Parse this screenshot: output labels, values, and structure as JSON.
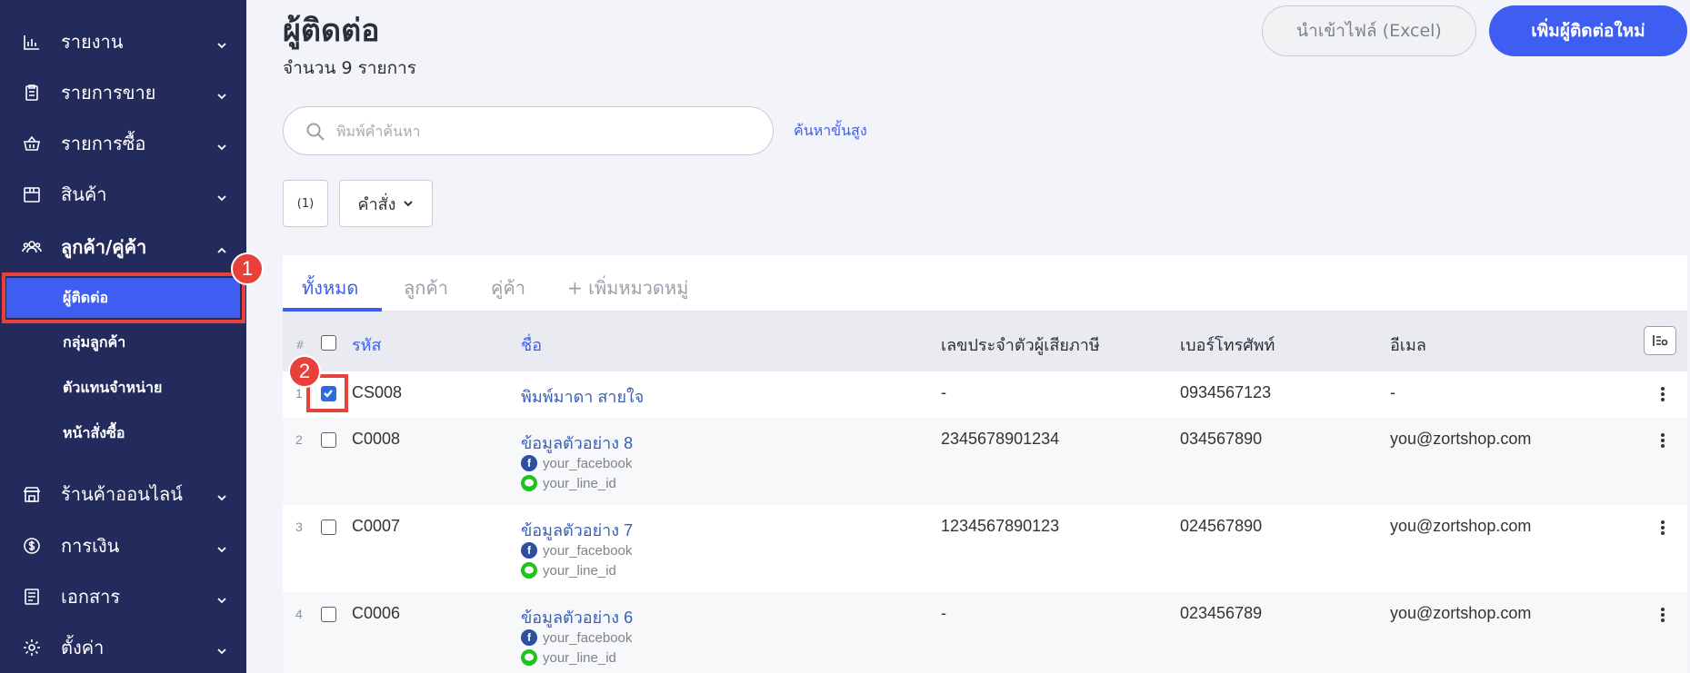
{
  "sidebar": {
    "items": [
      {
        "label": "รายงาน",
        "icon": "bar-chart-icon"
      },
      {
        "label": "รายการขาย",
        "icon": "clipboard-icon"
      },
      {
        "label": "รายการซื้อ",
        "icon": "basket-icon"
      },
      {
        "label": "สินค้า",
        "icon": "box-icon"
      },
      {
        "label": "ลูกค้า/คู่ค้า",
        "icon": "users-icon"
      },
      {
        "label": "ร้านค้าออนไลน์",
        "icon": "store-icon"
      },
      {
        "label": "การเงิน",
        "icon": "dollar-coin-icon"
      },
      {
        "label": "เอกสาร",
        "icon": "document-icon"
      },
      {
        "label": "ตั้งค่า",
        "icon": "gear-icon"
      }
    ],
    "sub_items": [
      {
        "label": "ผู้ติดต่อ"
      },
      {
        "label": "กลุ่มลูกค้า"
      },
      {
        "label": "ตัวแทนจำหน่าย"
      },
      {
        "label": "หน้าสั่งซื้อ"
      }
    ]
  },
  "annotations": {
    "badge1": "1",
    "badge2": "2",
    "color": "#e8403a"
  },
  "header": {
    "title": "ผู้ติดต่อ",
    "subtitle": "จำนวน 9 รายการ",
    "import_label": "นำเข้าไฟล์ (Excel)",
    "add_label": "เพิ่มผู้ติดต่อใหม่"
  },
  "search": {
    "placeholder": "พิมพ์คำค้นหา",
    "advanced_label": "ค้นหาขั้นสูง"
  },
  "toolbar": {
    "count_label": "(1)",
    "command_label": "คำสั่ง"
  },
  "tabs": [
    {
      "label": "ทั้งหมด",
      "active": true
    },
    {
      "label": "ลูกค้า"
    },
    {
      "label": "คู่ค้า"
    },
    {
      "label": "+ เพิ่มหมวดหมู่"
    }
  ],
  "table": {
    "columns": {
      "hash": "#",
      "code": "รหัส",
      "name": "ชื่อ",
      "tax_id": "เลขประจำตัวผู้เสียภาษี",
      "phone": "เบอร์โทรศัพท์",
      "email": "อีเมล"
    },
    "rows": [
      {
        "num": "1",
        "code": "CS008",
        "name": "พิมพ์มาดา สายใจ",
        "tax_id": "-",
        "phone": "0934567123",
        "email": "-",
        "checked": true
      },
      {
        "num": "2",
        "code": "C0008",
        "name": "ข้อมูลตัวอย่าง 8",
        "facebook": "your_facebook",
        "line": "your_line_id",
        "tax_id": "2345678901234",
        "phone": "034567890",
        "email": "you@zortshop.com",
        "checked": false
      },
      {
        "num": "3",
        "code": "C0007",
        "name": "ข้อมูลตัวอย่าง 7",
        "facebook": "your_facebook",
        "line": "your_line_id",
        "tax_id": "1234567890123",
        "phone": "024567890",
        "email": "you@zortshop.com",
        "checked": false
      },
      {
        "num": "4",
        "code": "C0006",
        "name": "ข้อมูลตัวอย่าง 6",
        "facebook": "your_facebook",
        "line": "your_line_id",
        "tax_id": "-",
        "phone": "023456789",
        "email": "you@zortshop.com",
        "checked": false
      }
    ]
  },
  "colors": {
    "sidebar": "#232a5c",
    "accent": "#3d5ef0",
    "link": "#3a5fb0",
    "background": "#f3f4f9"
  }
}
